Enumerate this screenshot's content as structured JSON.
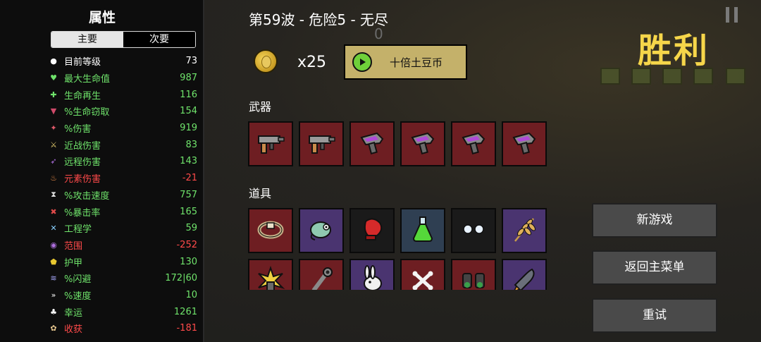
{
  "stats": {
    "title": "属性",
    "tabs": [
      "主要",
      "次要"
    ],
    "rows": [
      {
        "name": "目前等级",
        "value": "73",
        "color": "#ffffff",
        "icon": "level-icon"
      },
      {
        "name": "最大生命值",
        "value": "987",
        "color": "#6fe36b",
        "icon": "heart-icon"
      },
      {
        "name": "生命再生",
        "value": "116",
        "color": "#6fe36b",
        "icon": "regen-icon"
      },
      {
        "name": "%生命窃取",
        "value": "154",
        "color": "#6fe36b",
        "icon": "lifesteal-icon"
      },
      {
        "name": "%伤害",
        "value": "919",
        "color": "#6fe36b",
        "icon": "damage-icon"
      },
      {
        "name": "近战伤害",
        "value": "83",
        "color": "#6fe36b",
        "icon": "melee-icon"
      },
      {
        "name": "远程伤害",
        "value": "143",
        "color": "#6fe36b",
        "icon": "ranged-icon"
      },
      {
        "name": "元素伤害",
        "value": "-21",
        "color": "#ff4a4a",
        "icon": "elemental-icon"
      },
      {
        "name": "%攻击速度",
        "value": "757",
        "color": "#6fe36b",
        "icon": "hourglass-icon"
      },
      {
        "name": "%暴击率",
        "value": "165",
        "color": "#6fe36b",
        "icon": "crit-icon"
      },
      {
        "name": "工程学",
        "value": "59",
        "color": "#6fe36b",
        "icon": "engineering-icon"
      },
      {
        "name": "范围",
        "value": "-252",
        "color": "#ff4a4a",
        "icon": "range-icon"
      },
      {
        "name": "护甲",
        "value": "130",
        "color": "#6fe36b",
        "icon": "shield-icon"
      },
      {
        "name": "%闪避",
        "value": "172|60",
        "color": "#6fe36b",
        "icon": "dodge-icon"
      },
      {
        "name": "%速度",
        "value": "10",
        "color": "#6fe36b",
        "icon": "speed-icon"
      },
      {
        "name": "幸运",
        "value": "1261",
        "color": "#6fe36b",
        "icon": "luck-icon"
      },
      {
        "name": "收获",
        "value": "-181",
        "color": "#ff4a4a",
        "icon": "harvest-icon"
      }
    ]
  },
  "run": {
    "wave_title": "第59波 - 危险5 - 无尽",
    "bg_counter": "0",
    "coin_count": "x25",
    "tenfold_button": "十倍土豆币"
  },
  "weapons_label": "武器",
  "items_label": "道具",
  "weapons": [
    {
      "icon": "smg-icon",
      "tier": "red"
    },
    {
      "icon": "smg-icon",
      "tier": "red"
    },
    {
      "icon": "blaster-icon",
      "tier": "red"
    },
    {
      "icon": "blaster-icon",
      "tier": "red"
    },
    {
      "icon": "blaster-icon",
      "tier": "red"
    },
    {
      "icon": "blaster-icon",
      "tier": "red"
    }
  ],
  "items": [
    {
      "icon": "ring-icon",
      "tier": "red"
    },
    {
      "icon": "chameleon-icon",
      "tier": "purple"
    },
    {
      "icon": "boxing-glove-icon",
      "tier": "black"
    },
    {
      "icon": "potion-icon",
      "tier": "blue"
    },
    {
      "icon": "eyes-icon",
      "tier": "black"
    },
    {
      "icon": "wheat-icon",
      "tier": "purple"
    },
    {
      "icon": "explosion-icon",
      "tier": "red"
    },
    {
      "icon": "wrench-icon",
      "tier": "red"
    },
    {
      "icon": "rabbit-icon",
      "tier": "purple"
    },
    {
      "icon": "bones-icon",
      "tier": "red"
    },
    {
      "icon": "binoculars-icon",
      "tier": "red"
    },
    {
      "icon": "rocket-icon",
      "tier": "purple"
    }
  ],
  "victory_title": "胜利",
  "buttons": {
    "new_game": "新游戏",
    "main_menu": "返回主菜单",
    "retry": "重试"
  }
}
